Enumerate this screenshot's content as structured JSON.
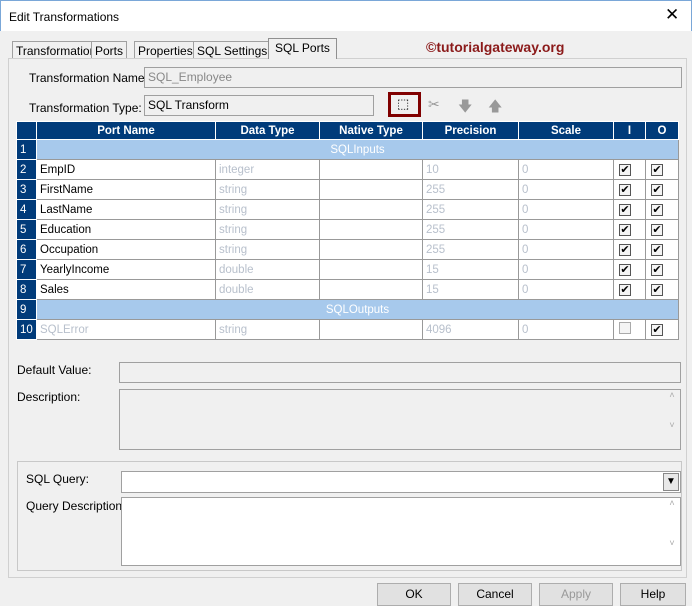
{
  "window": {
    "title": "Edit Transformations",
    "close": "✕"
  },
  "tabs": [
    "Transformation",
    "Ports",
    "Properties",
    "SQL Settings",
    "SQL Ports"
  ],
  "brand": "©tutorialgateway.org",
  "form": {
    "name_label": "Transformation Name:",
    "name_value": "SQL_Employee",
    "type_label": "Transformation Type:",
    "type_value": "SQL Transform"
  },
  "toolbar": {
    "new": "⬚",
    "cut": "✂",
    "down": "🡇",
    "up": "🡅"
  },
  "grid": {
    "columns": [
      "Port Name",
      "Data Type",
      "Native Type",
      "Precision",
      "Scale",
      "I",
      "O"
    ],
    "rows": [
      {
        "n": "1",
        "group": "SQLInputs"
      },
      {
        "n": "2",
        "name": "EmpID",
        "type": "integer",
        "native": "",
        "precision": "10",
        "scale": "0",
        "i": "✔",
        "o": "✔"
      },
      {
        "n": "3",
        "name": "FirstName",
        "type": "string",
        "native": "",
        "precision": "255",
        "scale": "0",
        "i": "✔",
        "o": "✔"
      },
      {
        "n": "4",
        "name": "LastName",
        "type": "string",
        "native": "",
        "precision": "255",
        "scale": "0",
        "i": "✔",
        "o": "✔"
      },
      {
        "n": "5",
        "name": "Education",
        "type": "string",
        "native": "",
        "precision": "255",
        "scale": "0",
        "i": "✔",
        "o": "✔"
      },
      {
        "n": "6",
        "name": "Occupation",
        "type": "string",
        "native": "",
        "precision": "255",
        "scale": "0",
        "i": "✔",
        "o": "✔"
      },
      {
        "n": "7",
        "name": "YearlyIncome",
        "type": "double",
        "native": "",
        "precision": "15",
        "scale": "0",
        "i": "✔",
        "o": "✔"
      },
      {
        "n": "8",
        "name": "Sales",
        "type": "double",
        "native": "",
        "precision": "15",
        "scale": "0",
        "i": "✔",
        "o": "✔"
      },
      {
        "n": "9",
        "group": "SQLOutputs"
      },
      {
        "n": "10",
        "name": "SQLError",
        "type": "string",
        "native": "",
        "precision": "4096",
        "scale": "0",
        "i": "",
        "o": "✔",
        "dim": true
      }
    ]
  },
  "details": {
    "default_label": "Default Value:",
    "default_value": "",
    "desc_label": "Description:",
    "desc_value": ""
  },
  "sql": {
    "query_label": "SQL Query:",
    "query_value": "",
    "qdesc_label": "Query Description:",
    "qdesc_value": ""
  },
  "buttons": {
    "ok": "OK",
    "cancel": "Cancel",
    "apply": "Apply",
    "help": "Help"
  }
}
